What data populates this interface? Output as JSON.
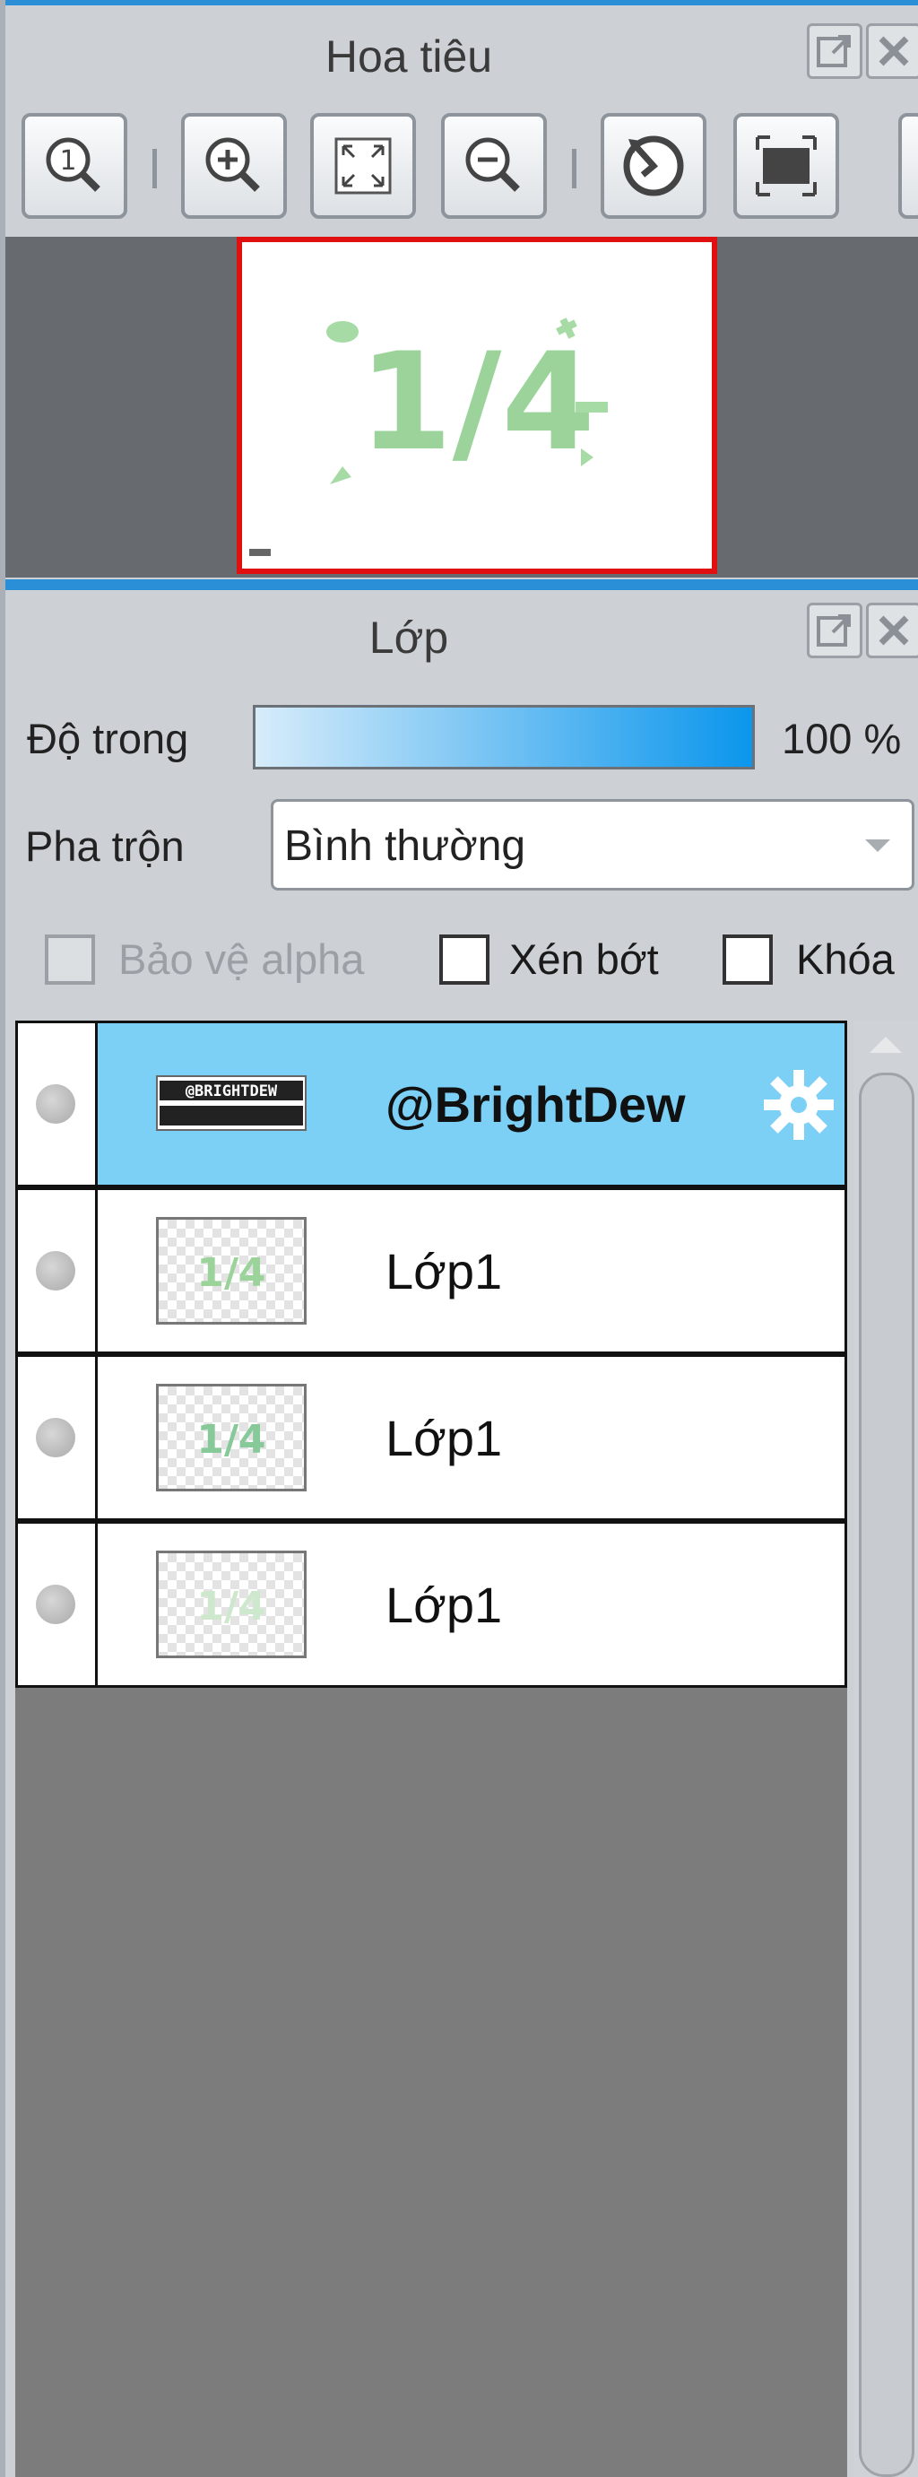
{
  "navigator": {
    "title": "Hoa tiêu",
    "toolbar": {
      "icons": [
        "zoom-actual-size-icon",
        "zoom-in-icon",
        "fit-to-window-icon",
        "zoom-out-icon",
        "rotate-reset-icon",
        "fullscreen-icon"
      ]
    },
    "preview": {
      "fraction_text": "1/4"
    }
  },
  "layers": {
    "title": "Lớp",
    "opacity_label": "Độ trong",
    "opacity_value": "100 %",
    "blend_label": "Pha trộn",
    "blend_value": "Bình thường",
    "protect_alpha_label": "Bảo vệ alpha",
    "clipping_label": "Xén bớt",
    "lock_label": "Khóa",
    "items": [
      {
        "name": "@BrightDew",
        "selected": true,
        "thumb_text": "@BRIGHTDEW"
      },
      {
        "name": "Lớp1",
        "selected": false
      },
      {
        "name": "Lớp1",
        "selected": false
      },
      {
        "name": "Lớp1",
        "selected": false
      }
    ]
  },
  "colors": {
    "accent": "#2a8fd6",
    "selected_row": "#7dd0f5",
    "nav_frame": "#e01010"
  }
}
